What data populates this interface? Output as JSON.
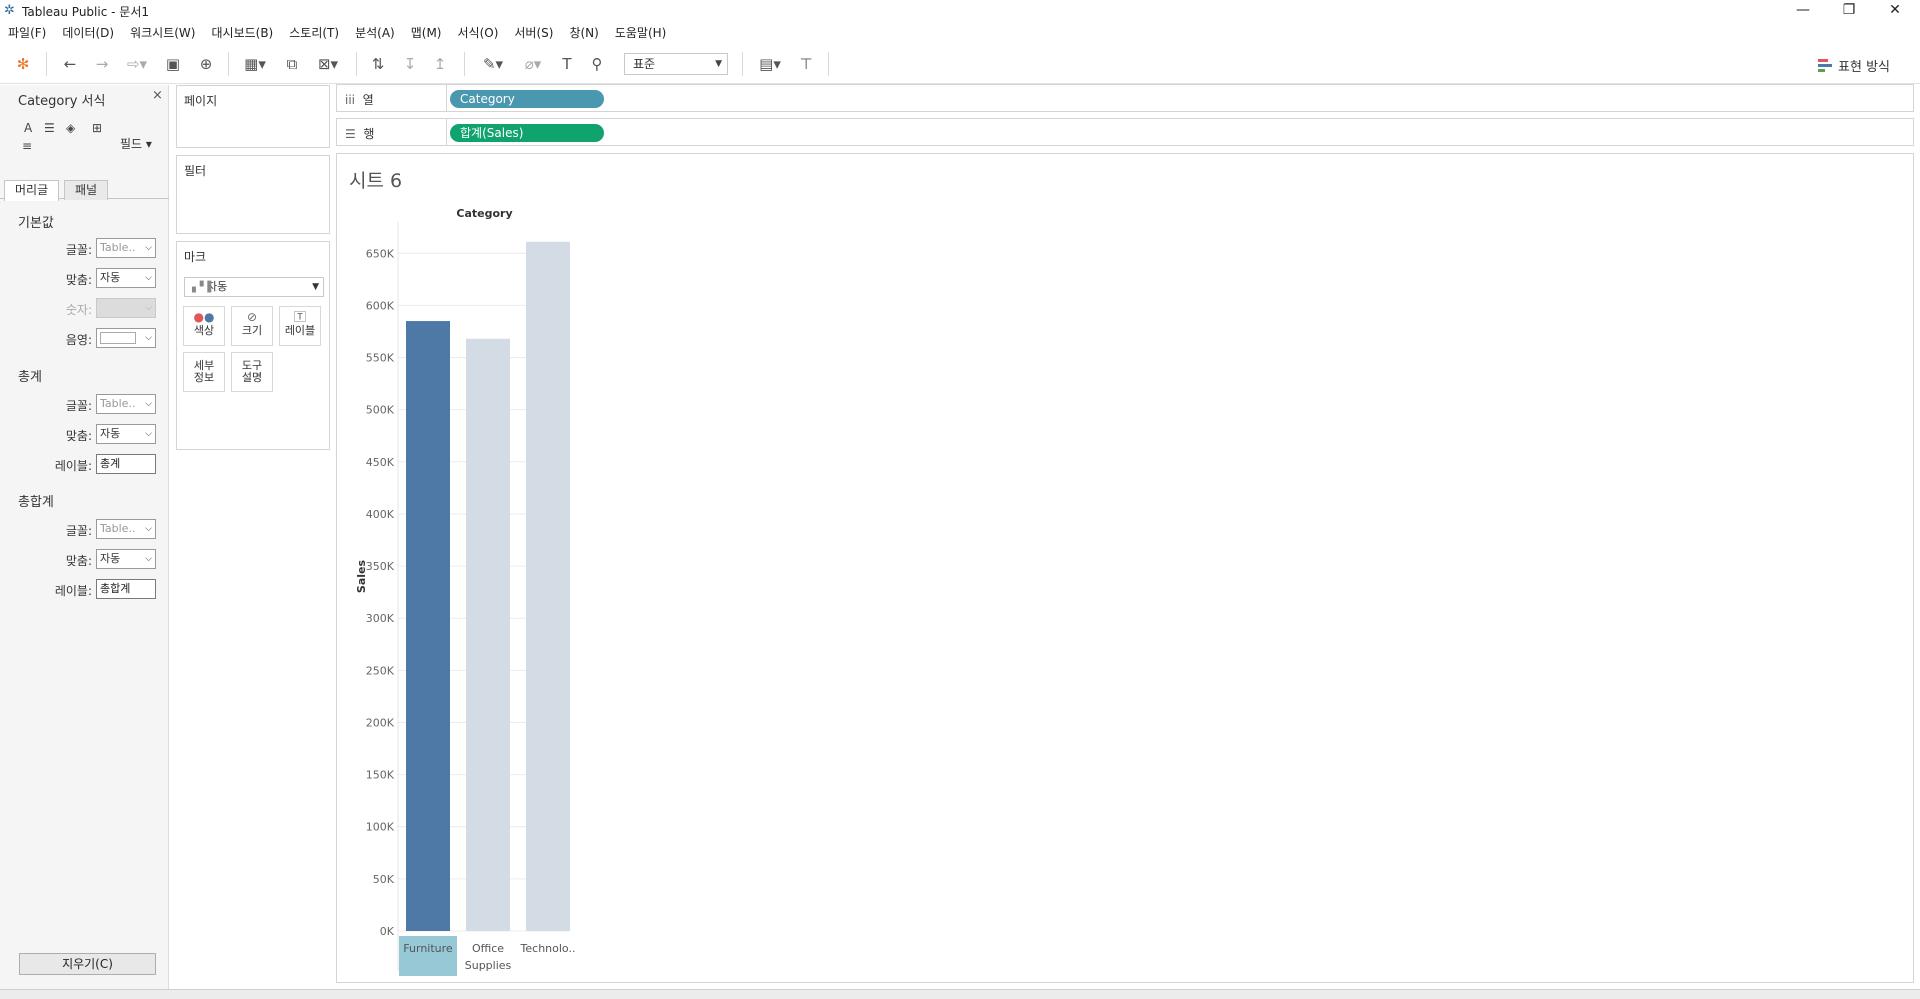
{
  "window": {
    "title": "Tableau Public - 문서1",
    "controls": {
      "minimize": "—",
      "restore": "❐",
      "close": "✕"
    }
  },
  "menu": [
    "파일(F)",
    "데이터(D)",
    "워크시트(W)",
    "대시보드(B)",
    "스토리(T)",
    "분석(A)",
    "맵(M)",
    "서식(O)",
    "서버(S)",
    "창(N)",
    "도움말(H)"
  ],
  "toolbar": {
    "fit_select": "표준",
    "show_me": "표현 방식",
    "colors": {
      "show_me_bars": [
        "#e15759",
        "#4e79a7",
        "#59a14f"
      ]
    }
  },
  "format_pane": {
    "title": "Category 서식",
    "close": "×",
    "field_button": "필드 ▾",
    "tabs": [
      "머리글",
      "패널"
    ],
    "sections": {
      "default": {
        "title": "기본값",
        "font_label": "글꼴:",
        "font_value": "Table..",
        "align_label": "맞춤:",
        "align_value": "자동",
        "number_label": "숫자:",
        "shading_label": "음영:"
      },
      "total": {
        "title": "총계",
        "font_label": "글꼴:",
        "font_value": "Table..",
        "align_label": "맞춤:",
        "align_value": "자동",
        "label_label": "레이블:",
        "label_value": "총계"
      },
      "grand_total": {
        "title": "총합계",
        "font_label": "글꼴:",
        "font_value": "Table..",
        "align_label": "맞춤:",
        "align_value": "자동",
        "label_label": "레이블:",
        "label_value": "총합계"
      }
    },
    "clear_button": "지우기(C)"
  },
  "cards": {
    "pages": "페이지",
    "filters": "필터",
    "marks": {
      "title": "마크",
      "type": "자동",
      "buttons": [
        {
          "line1": "색상",
          "line2": ""
        },
        {
          "line1": "크기",
          "line2": ""
        },
        {
          "line1": "레이블",
          "line2": ""
        },
        {
          "line1": "세부",
          "line2": "정보"
        },
        {
          "line1": "도구",
          "line2": "설명"
        }
      ]
    }
  },
  "shelves": {
    "columns": {
      "label": "열",
      "pill": "Category",
      "color": "#4a98b0"
    },
    "rows": {
      "label": "행",
      "pill": "합계(Sales)",
      "color": "#10a36e"
    }
  },
  "sheet": {
    "title": "시트 6"
  },
  "chart_data": {
    "type": "bar",
    "title": "",
    "header": "Category",
    "ylabel": "Sales",
    "xlabel": "",
    "categories": [
      "Furniture",
      "Office Supplies",
      "Technolo.."
    ],
    "category_lines": [
      [
        "Furniture"
      ],
      [
        "Office",
        "Supplies"
      ],
      [
        "Technolo.."
      ]
    ],
    "values": [
      585000,
      568000,
      661000
    ],
    "ylim": [
      0,
      680000
    ],
    "yticks": [
      0,
      50000,
      100000,
      150000,
      200000,
      250000,
      300000,
      350000,
      400000,
      450000,
      500000,
      550000,
      600000,
      650000
    ],
    "ytick_labels": [
      "0K",
      "50K",
      "100K",
      "150K",
      "200K",
      "250K",
      "300K",
      "350K",
      "400K",
      "450K",
      "500K",
      "550K",
      "600K",
      "650K"
    ],
    "grid": true,
    "legend": "none",
    "highlighted": "Furniture",
    "colors": {
      "highlight": "#4e79a7",
      "dimmed": "#d3dce4",
      "label_highlight": "#96c8d6",
      "grid": "#ececec"
    }
  }
}
